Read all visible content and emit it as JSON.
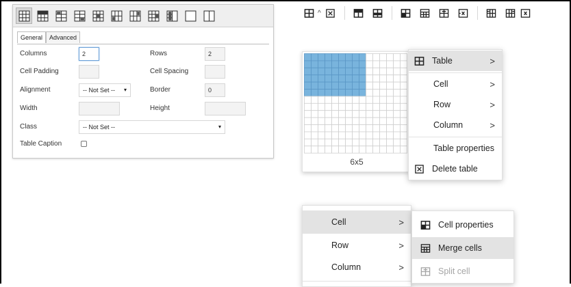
{
  "dialog": {
    "tabs": [
      "General",
      "Advanced"
    ],
    "fields": {
      "columns": {
        "label": "Columns",
        "value": "2"
      },
      "rows": {
        "label": "Rows",
        "value": "2"
      },
      "cell_padding": {
        "label": "Cell Padding",
        "value": ""
      },
      "cell_spacing": {
        "label": "Cell Spacing",
        "value": ""
      },
      "alignment": {
        "label": "Alignment",
        "value": "-- Not Set --"
      },
      "border": {
        "label": "Border",
        "value": "0"
      },
      "width": {
        "label": "Width",
        "value": ""
      },
      "height": {
        "label": "Height",
        "value": ""
      },
      "class": {
        "label": "Class",
        "value": "-- Not Set --"
      },
      "table_caption": {
        "label": "Table Caption",
        "checked": false
      }
    }
  },
  "picker": {
    "label": "6x5",
    "cols_selected": 6,
    "rows_selected": 5,
    "highlight_color": "#79b4dd"
  },
  "table_menu": {
    "items": [
      {
        "label": "Table",
        "submenu": true,
        "icon": "table-icon"
      },
      {
        "label": "Cell",
        "submenu": true
      },
      {
        "label": "Row",
        "submenu": true
      },
      {
        "label": "Column",
        "submenu": true
      },
      {
        "label": "Table properties"
      },
      {
        "label": "Delete table",
        "icon": "delete-table-icon"
      }
    ]
  },
  "cell_menu": {
    "items": [
      {
        "label": "Cell",
        "submenu": true
      },
      {
        "label": "Row",
        "submenu": true
      },
      {
        "label": "Column",
        "submenu": true
      }
    ]
  },
  "cell_submenu": {
    "items": [
      {
        "label": "Cell properties",
        "icon": "cell-properties-icon"
      },
      {
        "label": "Merge cells",
        "icon": "merge-cells-icon"
      },
      {
        "label": "Split cell",
        "icon": "split-cell-icon",
        "disabled": true
      }
    ]
  },
  "icons": {
    "chevron": ">",
    "caret": "^"
  }
}
